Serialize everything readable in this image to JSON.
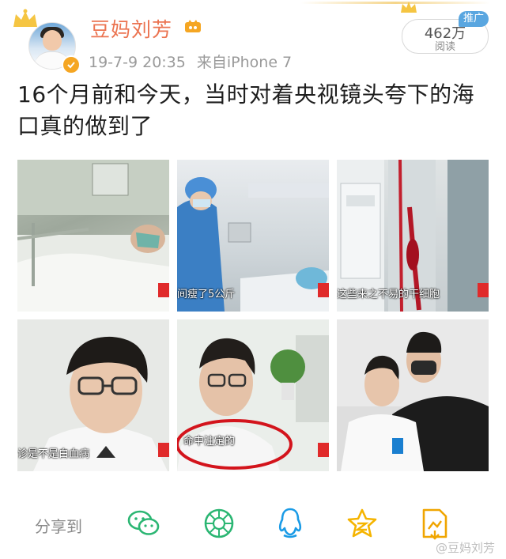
{
  "post": {
    "author": "豆妈刘芳",
    "time": "19-7-9 20:35",
    "source": "来自iPhone 7",
    "text": "16个月前和今天，当时对着央视镜头夸下的海口真的做到了",
    "reads": "462万",
    "reads_label": "阅读",
    "promo": "推广"
  },
  "images": [
    {
      "caption": ""
    },
    {
      "caption": "间瘦了5公斤"
    },
    {
      "caption": "这些来之不易的干细胞"
    },
    {
      "caption": "诊是不是白血病"
    },
    {
      "caption": "命中注定的"
    },
    {
      "caption": ""
    }
  ],
  "share": {
    "label": "分享到",
    "targets": [
      "wechat-icon",
      "moments-icon",
      "qq-icon",
      "qzone-icon",
      "save-image-icon"
    ]
  },
  "watermark": "@豆妈刘芳",
  "colors": {
    "name": "#eb7350",
    "accent": "#2bb673",
    "qq": "#1a9be6",
    "qzone": "#f5b400"
  }
}
